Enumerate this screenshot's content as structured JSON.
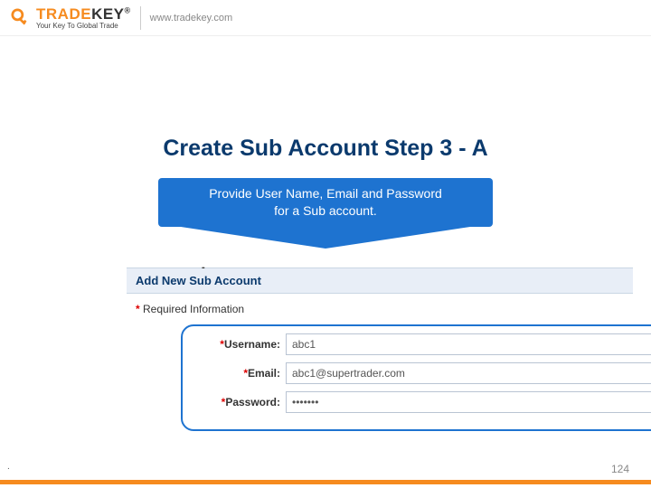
{
  "header": {
    "logo_trade": "TRADE",
    "logo_key": "KEY",
    "logo_reg": "®",
    "logo_tagline": "Your Key To Global Trade",
    "url": "www.tradekey.com"
  },
  "slide": {
    "title": "Create Sub Account Step 3 - A",
    "callout_line1": "Provide User Name, Email  and Password",
    "callout_line2": "for a Sub account."
  },
  "form": {
    "header": "Add New Sub Account",
    "required_star": "*",
    "required_text": " Required Information",
    "username_label": "Username:",
    "username_value": "abc1",
    "email_label": "Email:",
    "email_value": "abc1@supertrader.com",
    "password_label": "Password:",
    "password_value": "•••••••",
    "tick": "-"
  },
  "footer": {
    "dot": ".",
    "page": "124"
  }
}
